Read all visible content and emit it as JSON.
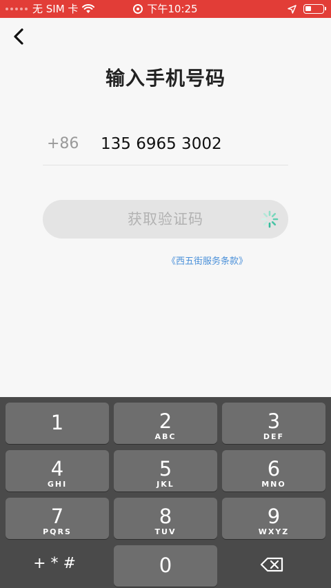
{
  "status_bar": {
    "carrier": "无 SIM 卡",
    "time": "下午10:25"
  },
  "page": {
    "title": "输入手机号码"
  },
  "phone": {
    "country_code": "+86",
    "number": "135 6965 3002"
  },
  "get_code_button": {
    "label": "获取验证码"
  },
  "terms": {
    "label": "《西五街服务条款》"
  },
  "keypad": {
    "keys": [
      {
        "digit": "1",
        "letters": ""
      },
      {
        "digit": "2",
        "letters": "ABC"
      },
      {
        "digit": "3",
        "letters": "DEF"
      },
      {
        "digit": "4",
        "letters": "GHI"
      },
      {
        "digit": "5",
        "letters": "JKL"
      },
      {
        "digit": "6",
        "letters": "MNO"
      },
      {
        "digit": "7",
        "letters": "PQRS"
      },
      {
        "digit": "8",
        "letters": "TUV"
      },
      {
        "digit": "9",
        "letters": "WXYZ"
      }
    ],
    "symbols": "+ * #",
    "zero": "0"
  },
  "colors": {
    "status_bar": "#e23d37",
    "keypad_bg": "#4a4a4a",
    "key_bg": "#6e6e6e",
    "link": "#4a90d9",
    "button_disabled": "#e4e4e4"
  },
  "icons": {
    "back": "chevron-left-icon",
    "spinner": "loading-spinner-icon",
    "delete": "backspace-icon",
    "wifi": "wifi-icon",
    "location": "location-arrow-icon",
    "battery": "battery-icon",
    "record": "screen-record-icon"
  }
}
